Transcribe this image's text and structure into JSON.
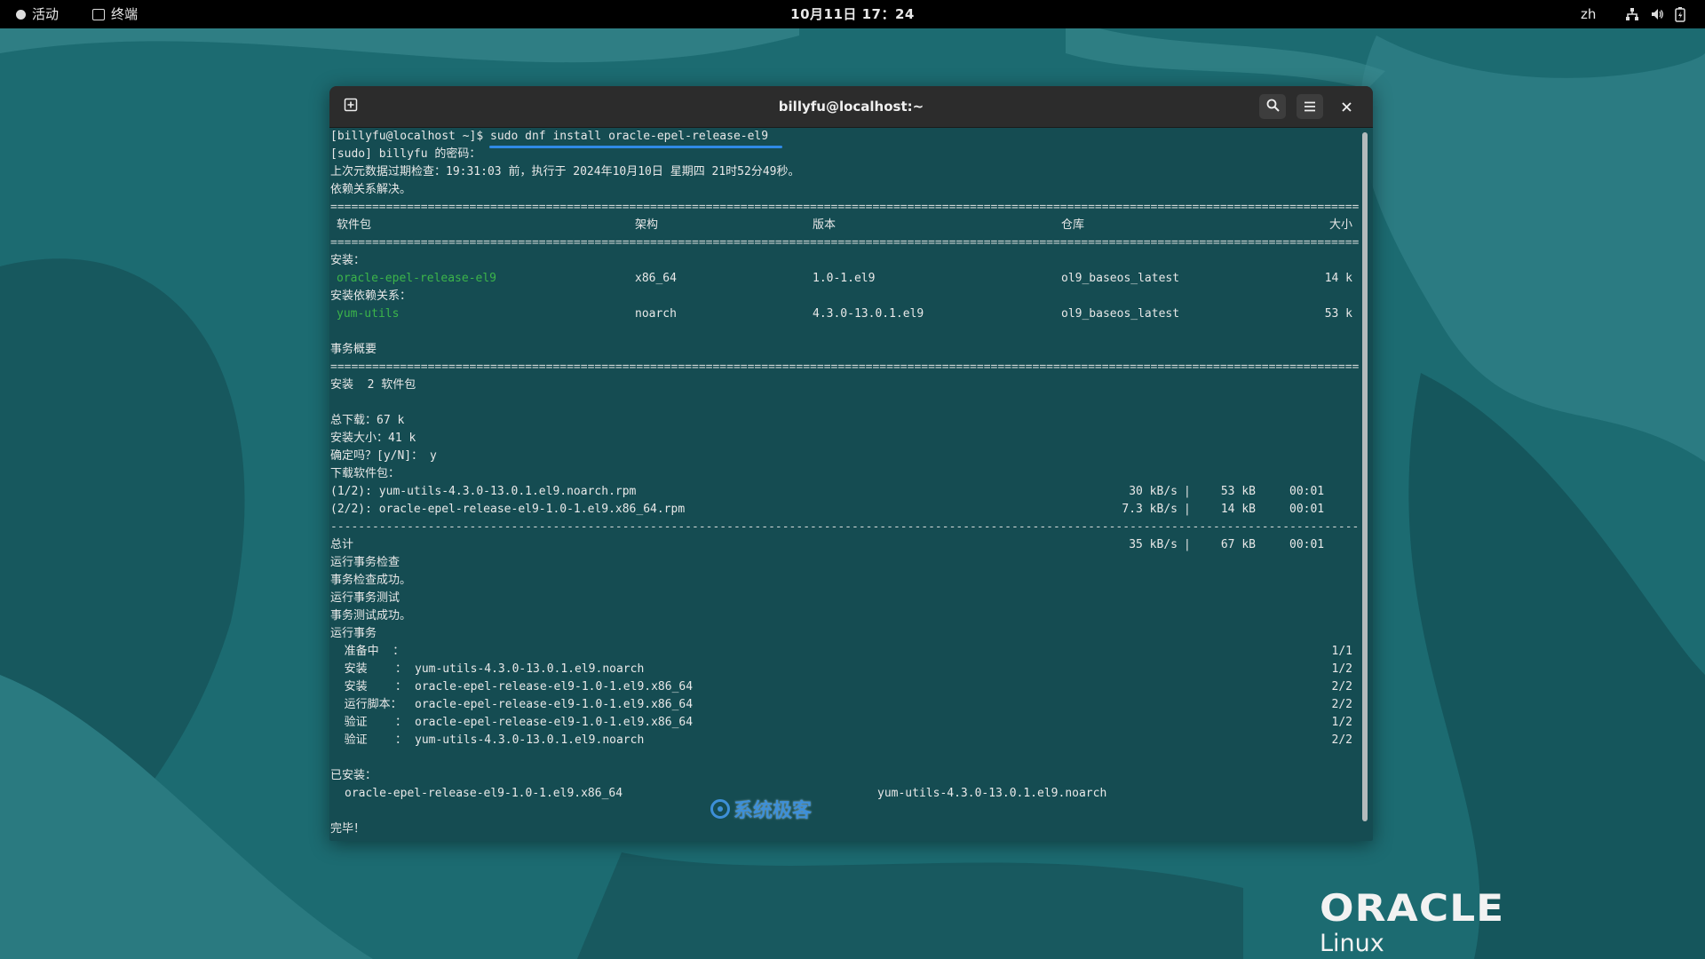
{
  "topbar": {
    "activities": "活动",
    "app_name": "终端",
    "clock": "10月11日 17：24",
    "lang": "zh"
  },
  "window": {
    "title": "billyfu@localhost:~"
  },
  "terminal": {
    "prompt_line": "[billyfu@localhost ~]$ sudo dnf install oracle-epel-release-el9",
    "sudo_line": "[sudo] billyfu 的密码：",
    "meta_line": "上次元数据过期检查：19:31:03 前，执行于 2024年10月10日 星期四 21时52分49秒。",
    "deps_resolved": "依赖关系解决。",
    "rule_eq": "================================================================================================================================================================",
    "rule_dash": "----------------------------------------------------------------------------------------------------------------------------------------------------------------",
    "table_headers": {
      "package": "软件包",
      "arch": "架构",
      "version": "版本",
      "repo": "仓库",
      "size": "大小"
    },
    "install_label": "安装：",
    "install_rows": [
      {
        "package": "oracle-epel-release-el9",
        "arch": "x86_64",
        "version": "1.0-1.el9",
        "repo": "ol9_baseos_latest",
        "size": "14 k"
      }
    ],
    "deps_label": "安装依赖关系：",
    "dep_rows": [
      {
        "package": "yum-utils",
        "arch": "noarch",
        "version": "4.3.0-13.0.1.el9",
        "repo": "ol9_baseos_latest",
        "size": "53 k"
      }
    ],
    "summary_label": "事务概要",
    "install_count": "安装  2 软件包",
    "total_download": "总下载：67 k",
    "install_size": "安装大小：41 k",
    "confirm": "确定吗？[y/N]： y",
    "downloading": "下载软件包：",
    "downloads": [
      {
        "name": "(1/2): yum-utils-4.3.0-13.0.1.el9.noarch.rpm",
        "speed": "30 kB/s",
        "size": "53 kB",
        "time": "00:01"
      },
      {
        "name": "(2/2): oracle-epel-release-el9-1.0-1.el9.x86_64.rpm",
        "speed": "7.3 kB/s",
        "size": "14 kB",
        "time": "00:01"
      }
    ],
    "total": {
      "label": "总计",
      "speed": "35 kB/s",
      "size": "67 kB",
      "time": "00:01"
    },
    "steps": [
      "运行事务检查",
      "事务检查成功。",
      "运行事务测试",
      "事务测试成功。",
      "运行事务"
    ],
    "actions": [
      {
        "label": "  准备中  ：",
        "item": "",
        "count": "1/1"
      },
      {
        "label": "  安装    ：",
        "item": "yum-utils-4.3.0-13.0.1.el9.noarch",
        "count": "1/2"
      },
      {
        "label": "  安装    ：",
        "item": "oracle-epel-release-el9-1.0-1.el9.x86_64",
        "count": "2/2"
      },
      {
        "label": "  运行脚本：",
        "item": "oracle-epel-release-el9-1.0-1.el9.x86_64",
        "count": "2/2"
      },
      {
        "label": "  验证    ：",
        "item": "oracle-epel-release-el9-1.0-1.el9.x86_64",
        "count": "1/2"
      },
      {
        "label": "  验证    ：",
        "item": "yum-utils-4.3.0-13.0.1.el9.noarch",
        "count": "2/2"
      }
    ],
    "installed_label": "已安装：",
    "installed": [
      "oracle-epel-release-el9-1.0-1.el9.x86_64",
      "yum-utils-4.3.0-13.0.1.el9.noarch"
    ],
    "done": "完毕！"
  },
  "watermark": "系统极客",
  "branding": {
    "word": "ORACLE",
    "sub": "Linux"
  },
  "colors": {
    "accent": "#2f8ae6",
    "package_green": "#3cb54a",
    "desktop": "#1f6a70"
  }
}
